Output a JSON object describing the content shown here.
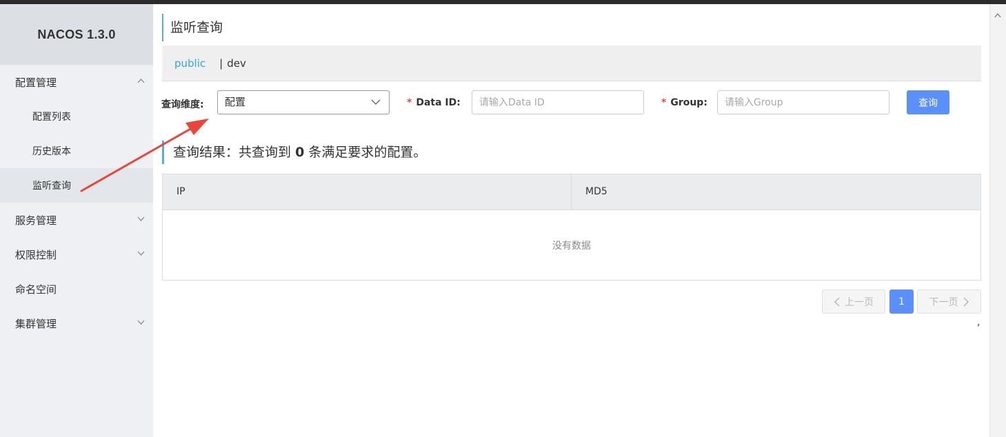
{
  "brand": {
    "title": "NACOS 1.3.0"
  },
  "sidebar": {
    "items": [
      {
        "label": "配置管理",
        "icon": "chevron-up-icon"
      },
      {
        "label": "配置列表"
      },
      {
        "label": "历史版本"
      },
      {
        "label": "监听查询"
      },
      {
        "label": "服务管理",
        "icon": "chevron-down-icon"
      },
      {
        "label": "权限控制",
        "icon": "chevron-down-icon"
      },
      {
        "label": "命名空间"
      },
      {
        "label": "集群管理",
        "icon": "chevron-down-icon"
      }
    ]
  },
  "page": {
    "title": "监听查询"
  },
  "namespaces": {
    "public": "public",
    "separator": "|",
    "dev": "dev"
  },
  "form": {
    "dimension_label": "查询维度:",
    "dimension_value": "配置",
    "required_mark": "*",
    "dataid_label": "Data ID:",
    "dataid_placeholder": "请输入Data ID",
    "group_label": "Group:",
    "group_placeholder": "请输入Group",
    "query_button": "查询"
  },
  "result": {
    "prefix": "查询结果：共查询到",
    "count": "0",
    "suffix": "条满足要求的配置。"
  },
  "table": {
    "columns": [
      "IP",
      "MD5"
    ],
    "empty_text": "没有数据"
  },
  "pagination": {
    "prev": "上一页",
    "current": "1",
    "next": "下一页"
  },
  "misc": {
    "trailing_mark": ","
  },
  "colors": {
    "accent": "#5b8ff9",
    "active_namespace": "#31a6d3",
    "annotation_arrow": "#e8463a",
    "title_bar": "#4fb3d9"
  }
}
